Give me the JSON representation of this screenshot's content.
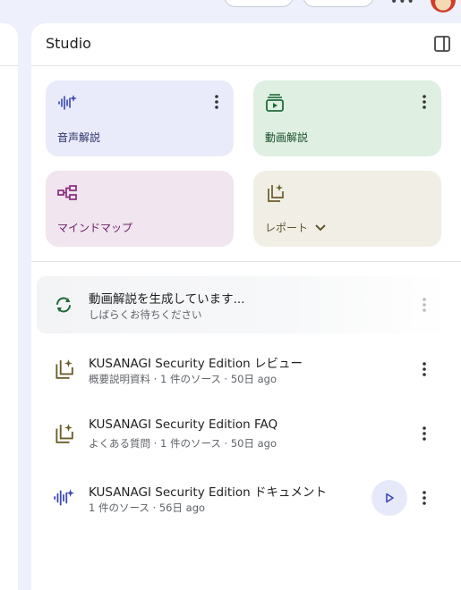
{
  "studio": {
    "title": "Studio"
  },
  "cards": [
    {
      "label": "音声解説",
      "icon": "waveform-icon"
    },
    {
      "label": "動画解説",
      "icon": "video-play-icon"
    },
    {
      "label": "マインドマップ",
      "icon": "mindmap-icon"
    },
    {
      "label": "レポート",
      "icon": "report-sparkle-icon"
    }
  ],
  "items": [
    {
      "title": "動画解説を生成しています...",
      "sub": "しばらくお待ちください",
      "icon": "refresh-sync-icon"
    },
    {
      "title": "KUSANAGI Security Edition レビュー",
      "sub": "概要説明資料 · 1 件のソース · 50日 ago",
      "icon": "report-sparkle-icon"
    },
    {
      "title": "KUSANAGI Security Edition FAQ",
      "sub": "よくある質問 · 1 件のソース · 50日 ago",
      "icon": "report-sparkle-icon"
    },
    {
      "title": "KUSANAGI Security Edition ドキュメント",
      "sub": "1 件のソース · 56日 ago",
      "icon": "waveform-icon"
    }
  ],
  "colors": {
    "background": "#eef0fb",
    "audio_card": "#e9ebfb",
    "video_card": "#dff0e3",
    "mindmap_card": "#f1e5ef",
    "report_card": "#f1efe5",
    "accent_blue": "#3a46b8",
    "accent_green": "#1e6b3a",
    "accent_purple": "#8a2a7e",
    "accent_olive": "#6b5d2a"
  }
}
